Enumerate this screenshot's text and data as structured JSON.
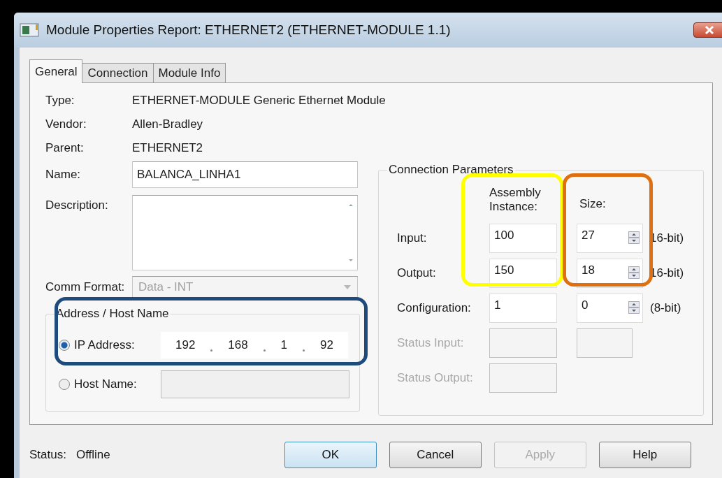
{
  "window": {
    "title": "Module Properties Report: ETHERNET2 (ETHERNET-MODULE 1.1)"
  },
  "tabs": [
    {
      "label": "General",
      "selected": true
    },
    {
      "label": "Connection",
      "selected": false
    },
    {
      "label": "Module Info",
      "selected": false
    }
  ],
  "general": {
    "fields": [
      {
        "label": "Type:",
        "value": "ETHERNET-MODULE Generic Ethernet Module"
      },
      {
        "label": "Vendor:",
        "value": "Allen-Bradley"
      },
      {
        "label": "Parent:",
        "value": "ETHERNET2"
      }
    ],
    "name": {
      "label": "Name:",
      "value": "BALANCA_LINHA1"
    },
    "description": {
      "label": "Description:"
    },
    "comm_format": {
      "label": "Comm Format:",
      "value": "Data - INT",
      "disabled": true
    },
    "address": {
      "title": "Address / Host Name",
      "options": [
        {
          "label": "IP Address:",
          "selected": true,
          "octets": [
            "192",
            "168",
            "1",
            "92"
          ]
        },
        {
          "label": "Host Name:",
          "selected": false
        }
      ]
    }
  },
  "connection_parameters": {
    "title": "Connection Parameters",
    "headers": [
      "Assembly Instance:",
      "Size:"
    ],
    "rows": [
      {
        "kind": "spinner",
        "label": "Input:",
        "instance": "100",
        "size": "27",
        "unit": "16-bit)",
        "disabled": false
      },
      {
        "kind": "spinner",
        "label": "Output:",
        "instance": "150",
        "size": "18",
        "unit": "16-bit)",
        "disabled": false
      },
      {
        "kind": "spinner",
        "label": "Configuration:",
        "instance": "1",
        "size": "0",
        "unit": "(8-bit)",
        "disabled": false
      },
      {
        "kind": "plain",
        "label": "Status Input:",
        "disabled": true
      },
      {
        "kind": "instance_only",
        "label": "Status Output:",
        "disabled": true
      }
    ]
  },
  "annotations": [
    {
      "color": "#ffff00"
    },
    {
      "color": "#e0700f"
    },
    {
      "color": "#1f4a7c"
    }
  ],
  "status": {
    "label": "Status:",
    "value": "Offline"
  },
  "buttons": [
    {
      "label": "OK",
      "default": true,
      "disabled": false
    },
    {
      "label": "Cancel",
      "default": false,
      "disabled": false
    },
    {
      "label": "Apply",
      "default": false,
      "disabled": true
    },
    {
      "label": "Help",
      "default": false,
      "disabled": false
    }
  ]
}
